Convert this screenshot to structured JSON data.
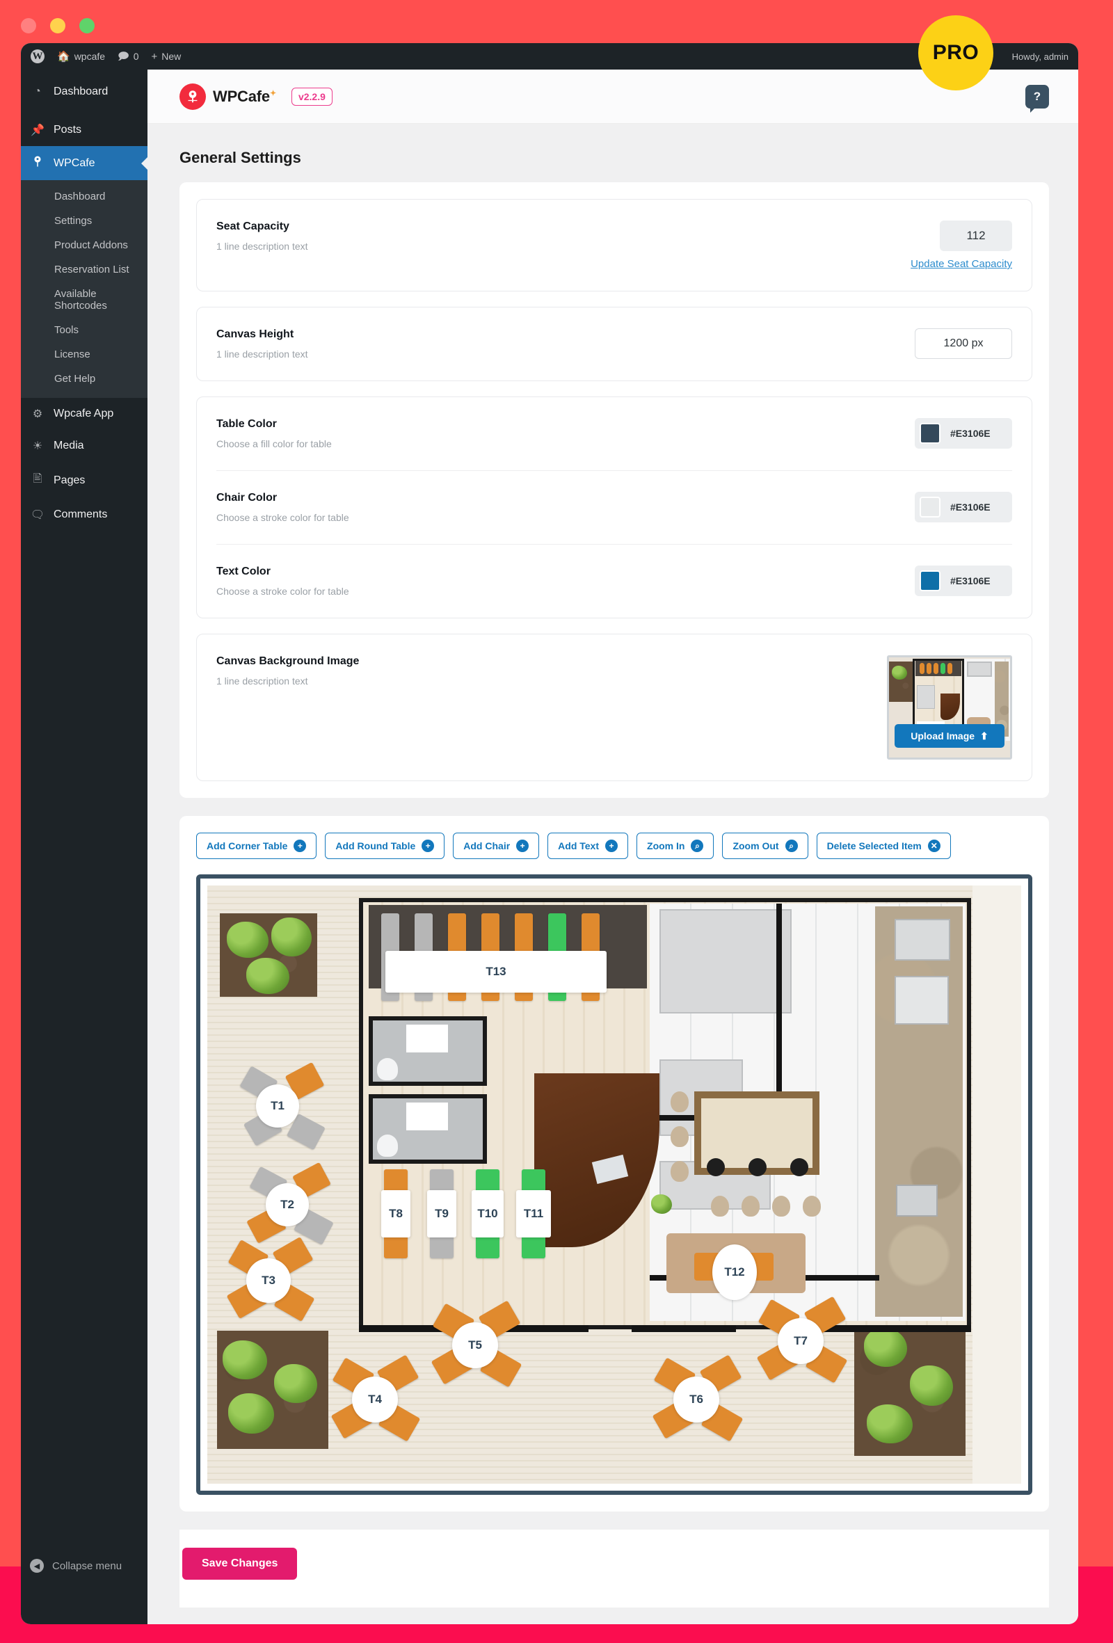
{
  "badge": {
    "pro_label": "PRO"
  },
  "adminbar": {
    "wp_logo": "wordpress-icon",
    "site_name": "wpcafe",
    "comments_count": "0",
    "new_label": "New",
    "howdy": "Howdy, admin"
  },
  "sidebar": {
    "top_items": [
      {
        "label": "Dashboard",
        "icon": "dashboard-icon"
      },
      {
        "label": "Posts",
        "icon": "pin-icon"
      }
    ],
    "current_item": {
      "label": "WPCafe",
      "icon": "wpcafe-icon"
    },
    "submenu": [
      "Dashboard",
      "Settings",
      "Product Addons",
      "Reservation List",
      "Available Shortcodes",
      "Tools",
      "License",
      "Get Help"
    ],
    "bottom_items": [
      {
        "label": "Wpcafe App",
        "icon": "gear-icon"
      },
      {
        "label": "Media",
        "icon": "media-icon"
      },
      {
        "label": "Pages",
        "icon": "pages-icon"
      },
      {
        "label": "Comments",
        "icon": "comment-icon"
      }
    ],
    "collapse_label": "Collapse menu"
  },
  "plugin_header": {
    "brand_name": "WPCafe",
    "version": "v2.2.9",
    "help_icon": "question-bubble-icon"
  },
  "page": {
    "title": "General Settings"
  },
  "settings": {
    "seat_capacity": {
      "title": "Seat Capacity",
      "desc": "1 line description text",
      "value": "112",
      "update_link": "Update Seat Capacity"
    },
    "canvas_height": {
      "title": "Canvas Height",
      "desc": "1 line description text",
      "value": "1200 px"
    },
    "table_color": {
      "title": "Table Color",
      "desc": "Choose a fill color for table",
      "hex": "#E3106E",
      "swatch": "#34495b"
    },
    "chair_color": {
      "title": "Chair Color",
      "desc": "Choose a stroke color for table",
      "hex": "#E3106E",
      "swatch": "#e9ebec"
    },
    "text_color": {
      "title": "Text Color",
      "desc": "Choose a stroke color for table",
      "hex": "#E3106E",
      "swatch": "#0f6fa8"
    },
    "canvas_bg": {
      "title": "Canvas Background Image",
      "desc": "1 line description text",
      "upload_label": "Upload Image",
      "upload_icon": "upload-icon"
    }
  },
  "editor": {
    "toolbar": [
      {
        "label": "Add Corner Table",
        "icon": "plus-icon",
        "glyph": "+"
      },
      {
        "label": "Add Round Table",
        "icon": "plus-icon",
        "glyph": "+"
      },
      {
        "label": "Add Chair",
        "icon": "plus-icon",
        "glyph": "+"
      },
      {
        "label": "Add Text",
        "icon": "plus-icon",
        "glyph": "+"
      },
      {
        "label": "Zoom In",
        "icon": "zoom-in-icon",
        "glyph": "⌕"
      },
      {
        "label": "Zoom Out",
        "icon": "zoom-out-icon",
        "glyph": "⌕"
      },
      {
        "label": "Delete Selected Item",
        "icon": "close-icon",
        "glyph": "✕"
      }
    ],
    "tables": [
      {
        "id": "T13",
        "shape": "rect"
      },
      {
        "id": "T1",
        "shape": "round"
      },
      {
        "id": "T2",
        "shape": "round"
      },
      {
        "id": "T3",
        "shape": "round"
      },
      {
        "id": "T8",
        "shape": "rect"
      },
      {
        "id": "T9",
        "shape": "rect"
      },
      {
        "id": "T10",
        "shape": "rect"
      },
      {
        "id": "T11",
        "shape": "rect"
      },
      {
        "id": "T12",
        "shape": "round"
      },
      {
        "id": "T4",
        "shape": "round"
      },
      {
        "id": "T5",
        "shape": "round"
      },
      {
        "id": "T6",
        "shape": "round"
      },
      {
        "id": "T7",
        "shape": "round"
      }
    ]
  },
  "footer": {
    "save_label": "Save Changes"
  },
  "colors": {
    "accent_pink": "#e31b6d",
    "accent_blue": "#1277bc",
    "backdrop_top": "#ff4f4f",
    "backdrop_bottom": "#fb0d4f",
    "pro_yellow": "#fcd116"
  }
}
